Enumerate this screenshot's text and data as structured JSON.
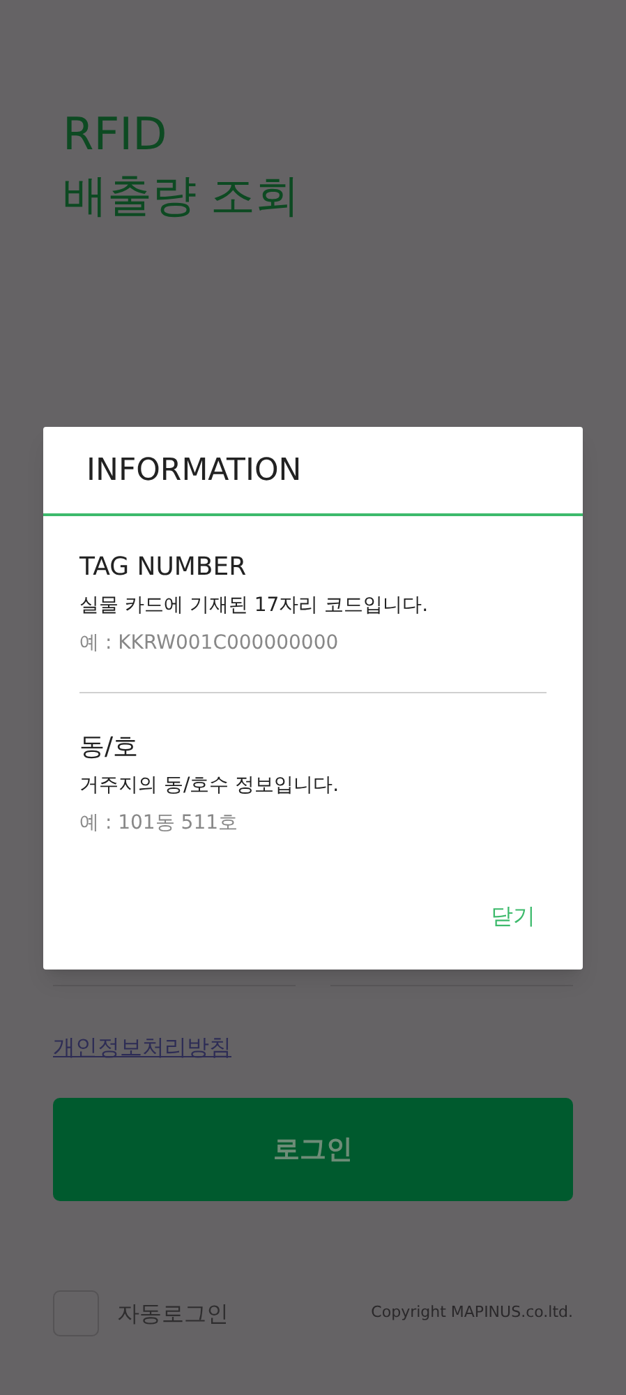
{
  "title_lines": [
    "RFID",
    "배출량 조회"
  ],
  "privacy_link": "개인정보처리방침",
  "login_button": "로그인",
  "auto_login": {
    "label": "자동로그인",
    "checked": false
  },
  "copyright": "Copyright MAPINUS.co.ltd.",
  "dialog": {
    "title": "INFORMATION",
    "sections": [
      {
        "heading": "TAG NUMBER",
        "description": "실물 카드에 기재된 17자리 코드입니다.",
        "example": "예 : KKRW001C000000000"
      },
      {
        "heading": "동/호",
        "description": "거주지의 동/호수 정보입니다.",
        "example": "예 : 101동 511호"
      }
    ],
    "close_button": "닫기"
  }
}
